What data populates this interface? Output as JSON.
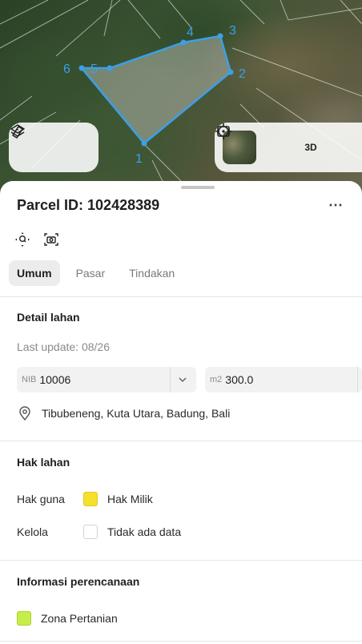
{
  "map": {
    "vertices": [
      "1",
      "2",
      "3",
      "4",
      "5",
      "6"
    ],
    "parcel_color": "#3aa0ea",
    "tools_left": [
      {
        "name": "layers-icon"
      },
      {
        "name": "draw-measure-icon"
      }
    ],
    "tools_right": {
      "thumbnail": "satellite-thumbnail",
      "locate": "crosshair-icon",
      "mode_3d": "3D",
      "next": "square-icon"
    }
  },
  "parcel": {
    "title": "Parcel ID: 102428389",
    "more": "⋯"
  },
  "tabs": [
    {
      "label": "Umum",
      "active": true
    },
    {
      "label": "Pasar",
      "active": false
    },
    {
      "label": "Tindakan",
      "active": false
    }
  ],
  "detail": {
    "heading": "Detail lahan",
    "last_update": "Last update: 08/26",
    "nib_prefix": "NIB",
    "nib_value": "10006",
    "area_prefix": "m2",
    "area_value": "300.0",
    "address": "Tibubeneng, Kuta Utara, Badung, Bali"
  },
  "hak": {
    "heading": "Hak lahan",
    "rows": [
      {
        "label": "Hak guna",
        "value": "Hak Milik",
        "color": "#f5e12c"
      },
      {
        "label": "Kelola",
        "value": "Tidak ada data",
        "color": "#ffffff"
      }
    ]
  },
  "planning": {
    "heading": "Informasi perencanaan",
    "zone": "Zona Pertanian",
    "zone_color": "#c6ee4a"
  }
}
